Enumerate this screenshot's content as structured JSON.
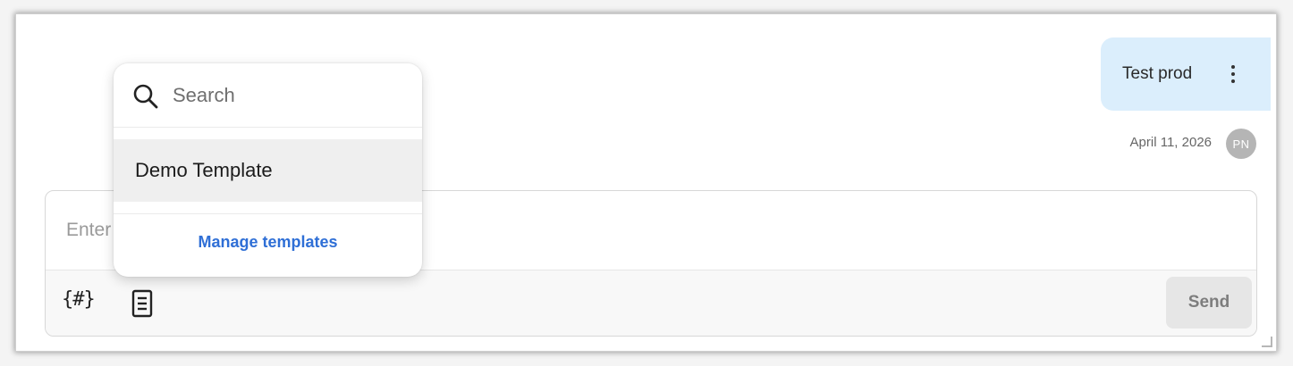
{
  "conversation": {
    "message": {
      "text": "Test prod",
      "timestamp": "April 11, 2026",
      "avatar_initials": "PN",
      "menu_icon": "kebab-menu-icon"
    }
  },
  "composer": {
    "placeholder": "Enter message",
    "variables_label": "{#}",
    "template_icon": "document-icon",
    "send_label": "Send"
  },
  "template_picker": {
    "search_placeholder": "Search",
    "search_icon": "search-icon",
    "items": [
      {
        "label": "Demo Template"
      }
    ],
    "manage_label": "Manage templates"
  },
  "colors": {
    "bubble_bg": "#dbeefc",
    "accent_link": "#2f6fd6",
    "send_disabled_bg": "#e6e6e6",
    "avatar_bg": "#b5b5b5"
  }
}
